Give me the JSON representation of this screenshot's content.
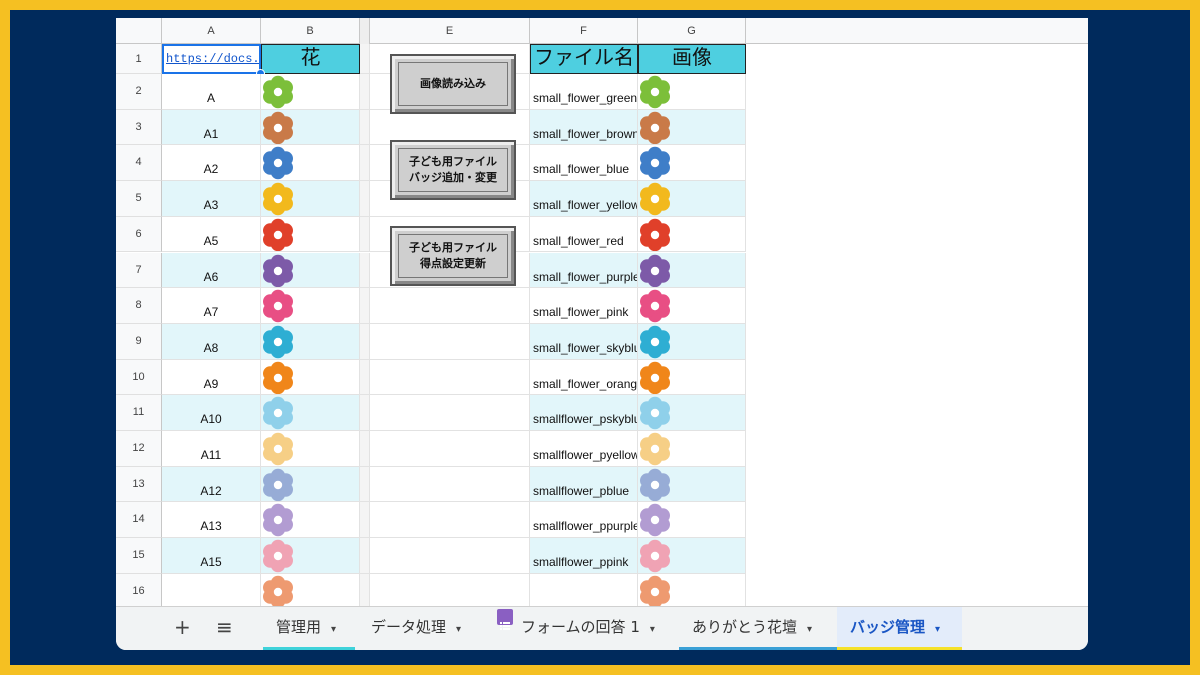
{
  "columns": [
    "A",
    "B",
    "E",
    "F",
    "G"
  ],
  "rows": [
    "1",
    "2",
    "3",
    "4",
    "5",
    "6",
    "7",
    "8",
    "9",
    "10",
    "11",
    "12",
    "13",
    "14",
    "15",
    "16"
  ],
  "header": {
    "link": "https://docs.google.com/",
    "flower": "花",
    "filename": "ファイル名",
    "image": "画像"
  },
  "buttons": {
    "load": "画像読み込み",
    "badge_line1": "子ども用ファイル",
    "badge_line2": "バッジ追加・変更",
    "score_line1": "子ども用ファイル",
    "score_line2": "得点設定更新"
  },
  "data_rows": [
    {
      "a": "A",
      "file": "small_flower_green",
      "color": "#7cbf3a"
    },
    {
      "a": "A1",
      "file": "small_flower_brown",
      "color": "#c97a48"
    },
    {
      "a": "A2",
      "file": "small_flower_blue",
      "color": "#3f7ec8"
    },
    {
      "a": "A3",
      "file": "small_flower_yellow",
      "color": "#f2b91d"
    },
    {
      "a": "A5",
      "file": "small_flower_red",
      "color": "#e0402a"
    },
    {
      "a": "A6",
      "file": "small_flower_purple",
      "color": "#7d5aa8"
    },
    {
      "a": "A7",
      "file": "small_flower_pink",
      "color": "#e84f84"
    },
    {
      "a": "A8",
      "file": "small_flower_skyblue",
      "color": "#2eaed3"
    },
    {
      "a": "A9",
      "file": "small_flower_orange",
      "color": "#f0861a"
    },
    {
      "a": "A10",
      "file": "smallflower_pskyblue",
      "color": "#8fd0ea"
    },
    {
      "a": "A11",
      "file": "smallflower_pyellow",
      "color": "#f6cf86"
    },
    {
      "a": "A12",
      "file": "smallflower_pblue",
      "color": "#97acd6"
    },
    {
      "a": "A13",
      "file": "smallflower_ppurple",
      "color": "#b29cd2"
    },
    {
      "a": "A15",
      "file": "smallflower_ppink",
      "color": "#f0a3b4"
    },
    {
      "a": "",
      "file": "",
      "color": "#ee9a70"
    }
  ],
  "tabs": {
    "add": "+",
    "list": "≡",
    "t1": "管理用",
    "t2": "データ処理",
    "t3": "フォームの回答 1",
    "t4": "ありがとう花壇",
    "t5": "バッジ管理",
    "arrow": "▾"
  },
  "colors": {
    "header_fill": "#4ecfe0",
    "stripe": "#e2f6fa",
    "active_tab_text": "#1a56c4"
  }
}
